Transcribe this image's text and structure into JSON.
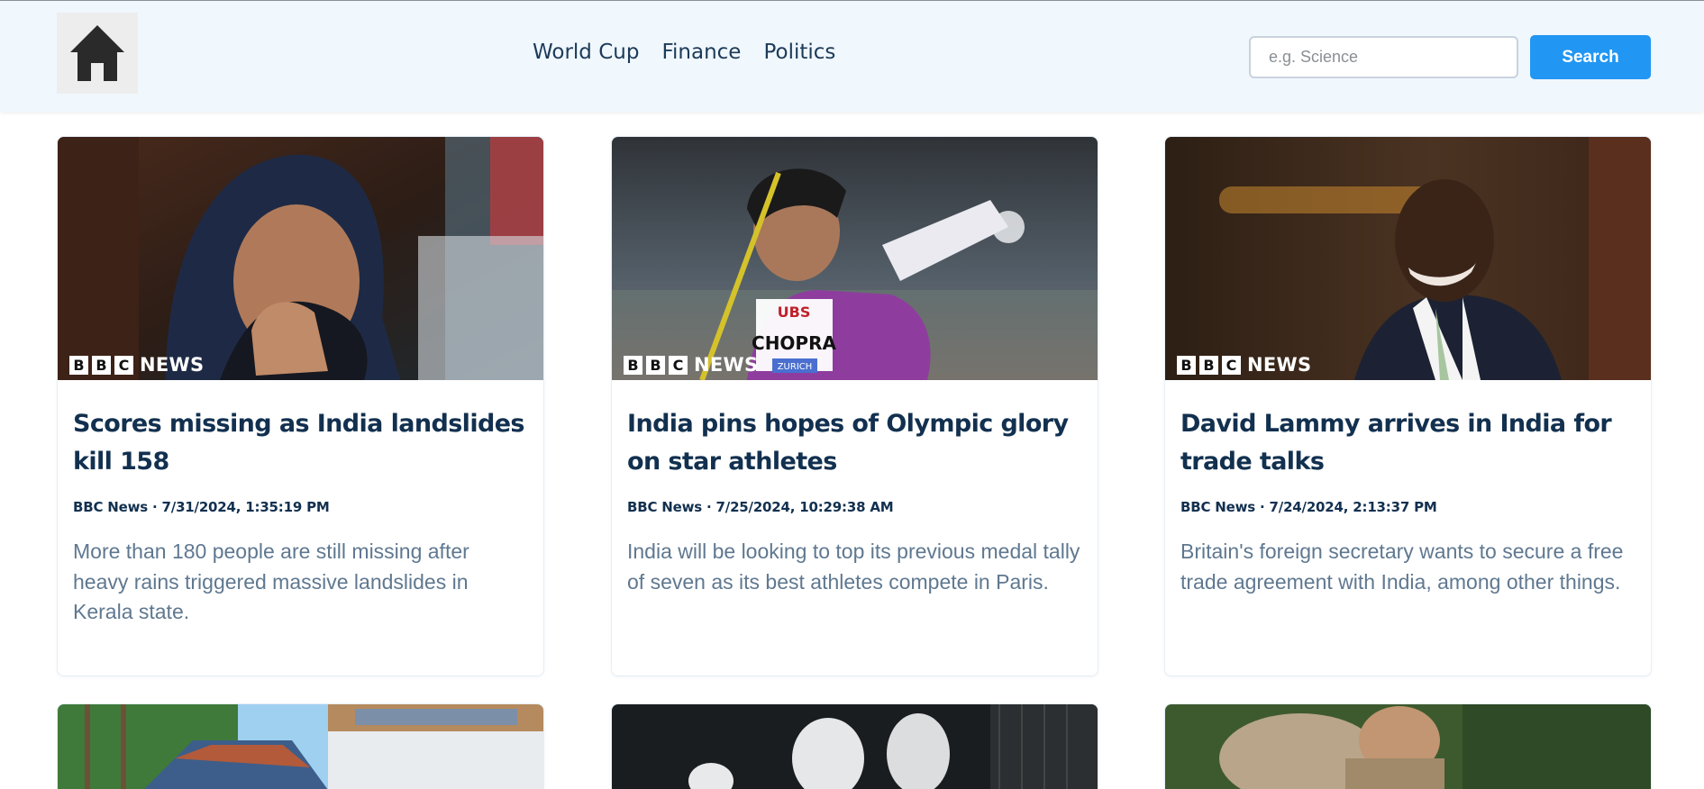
{
  "nav": {
    "links": [
      "World Cup",
      "Finance",
      "Politics"
    ],
    "search_placeholder": "e.g. Science",
    "search_value": "",
    "search_label": "Search",
    "home_icon": "home-icon"
  },
  "brand": {
    "letters": [
      "B",
      "B",
      "C"
    ],
    "wordmark": "NEWS"
  },
  "colors": {
    "accent": "#2196f3",
    "title": "#12304f",
    "description": "#5f7890",
    "nav_background": "#f0f7fd"
  },
  "articles": [
    {
      "title": "Scores missing as India landslides kill 158",
      "meta": "BBC News · 7/31/2024, 1:35:19 PM",
      "description": "More than 180 people are still missing after heavy rains triggered massive landslides in Kerala state."
    },
    {
      "title": "India pins hopes of Olympic glory on star athletes",
      "meta": "BBC News · 7/25/2024, 10:29:38 AM",
      "description": "India will be looking to top its previous medal tally of seven as its best athletes compete in Paris."
    },
    {
      "title": "David Lammy arrives in India for trade talks",
      "meta": "BBC News · 7/24/2024, 2:13:37 PM",
      "description": "Britain's foreign secretary wants to secure a free trade agreement with India, among other things."
    }
  ]
}
